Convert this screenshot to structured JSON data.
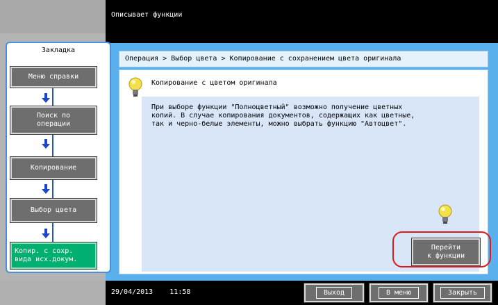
{
  "header": {
    "title": "Описывает функции"
  },
  "sidebar": {
    "heading": "Закладка",
    "items": [
      {
        "label": "Меню справки"
      },
      {
        "label": "Поиск по\nоперации"
      },
      {
        "label": "Копирование"
      },
      {
        "label": "Выбор цвета"
      },
      {
        "label": "Копир. с сохр.\nвида исх.докум."
      }
    ]
  },
  "breadcrumb": "Операция > Выбор цвета > Копирование с сохранением цвета оригинала",
  "content": {
    "title": "Копирование с цветом оригинала",
    "description": "При выборе функции \"Полноцветный\" возможно получение цветных\nкопий. В случае копирования документов, содержащих как цветные,\nтак и черно-белые элементы, можно выбрать функцию \"Автоцвет\"."
  },
  "goto_button": {
    "line1": "Перейти",
    "line2": "к функции"
  },
  "footer": {
    "datetime": "29/04/2013    11:58",
    "exit_label": "Выход",
    "menu_label": "В меню",
    "close_label": "Закрыть"
  },
  "colors": {
    "accent_blue": "#5ab0ec",
    "highlight_red": "#e01818",
    "active_green": "#00b070"
  }
}
